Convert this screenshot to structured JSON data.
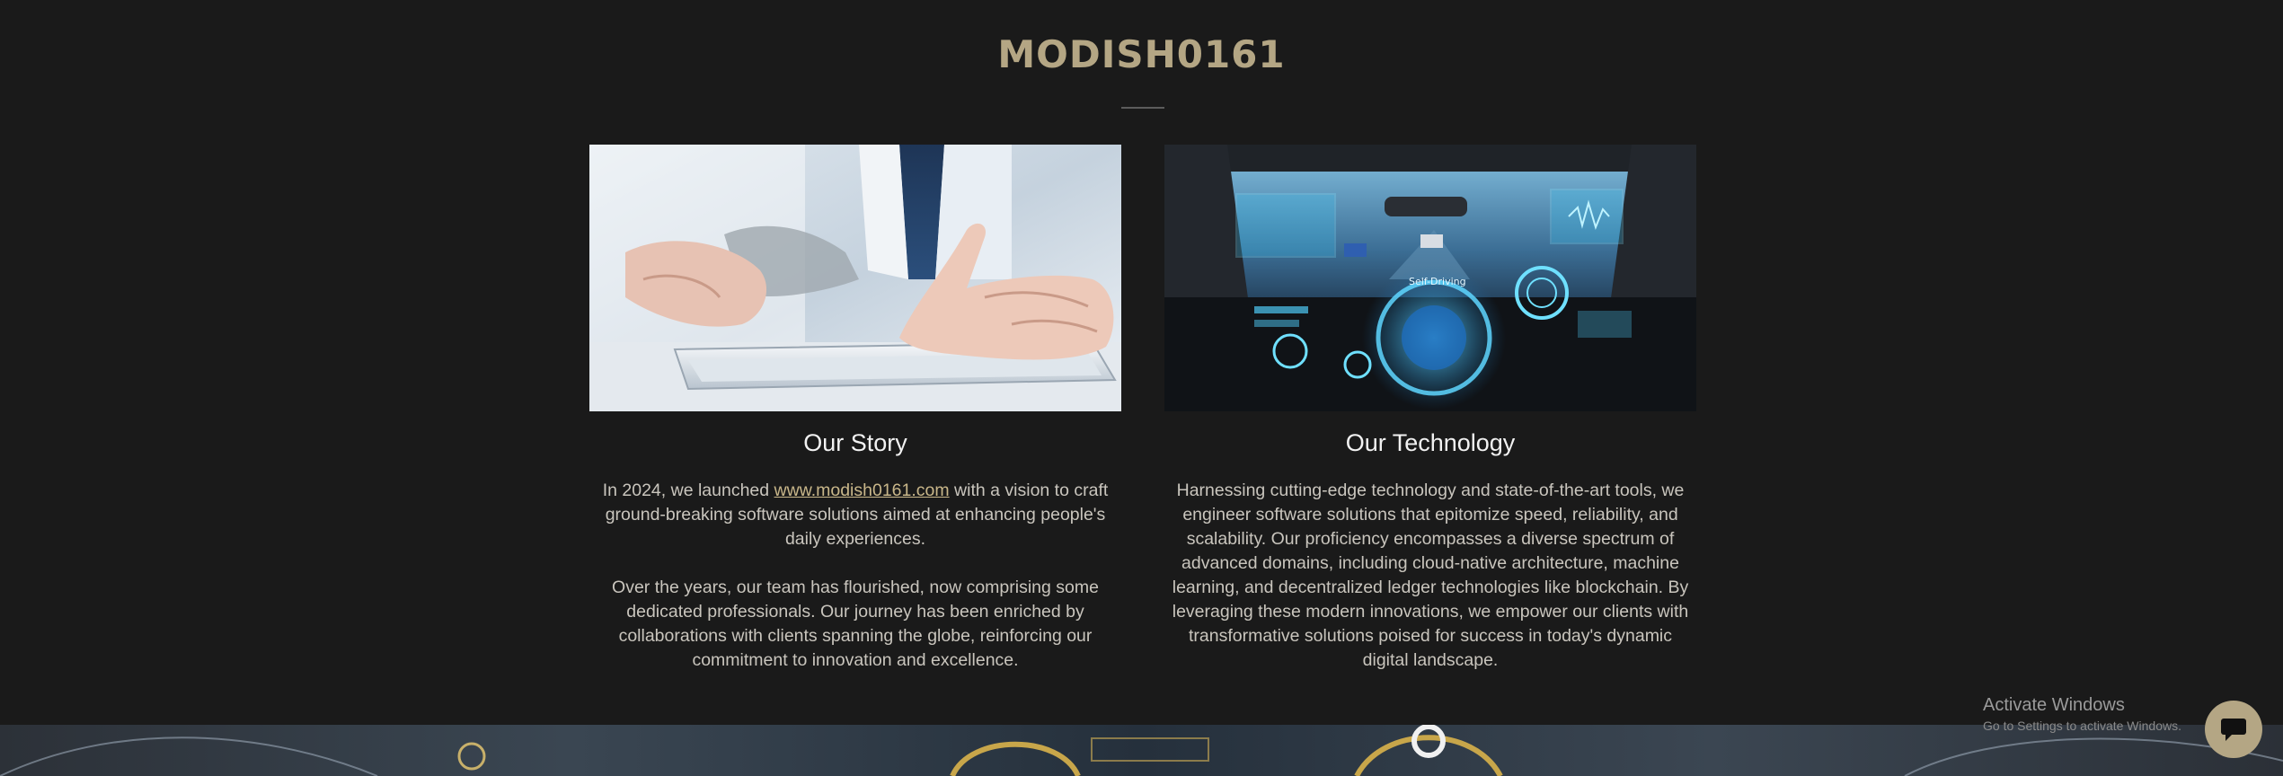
{
  "header": {
    "title": "MODISH0161"
  },
  "story": {
    "image_icon": "hand-on-tablet-photo",
    "heading": "Our Story",
    "p1_before": "In 2024, we launched ",
    "p1_link": "www.modish0161.com",
    "p1_after": " with a vision to craft ground-breaking software solutions aimed at enhancing people's daily experiences.",
    "p2": "Over the years, our team has flourished, now comprising some dedicated professionals. Our journey has been enriched by collaborations with clients spanning the globe, reinforcing our commitment to innovation and excellence."
  },
  "technology": {
    "image_icon": "self-driving-car-dashboard-photo",
    "image_overlay_label": "Self-Driving",
    "heading": "Our Technology",
    "p1": "Harnessing cutting-edge technology and state-of-the-art tools, we engineer software solutions that epitomize speed, reliability, and scalability. Our proficiency encompasses a diverse spectrum of advanced domains, including cloud-native architecture, machine learning, and decentralized ledger technologies like blockchain. By leveraging these modern innovations, we empower our clients with transformative solutions poised for success in today's dynamic digital landscape."
  },
  "os_overlay": {
    "title": "Activate Windows",
    "subtitle": "Go to Settings to activate Windows."
  },
  "chat": {
    "icon": "chat-bubble-icon"
  },
  "colors": {
    "background": "#1a1a1a",
    "accent": "#b4a684",
    "text": "#c9c5bd",
    "heading": "#f2f2f2"
  }
}
